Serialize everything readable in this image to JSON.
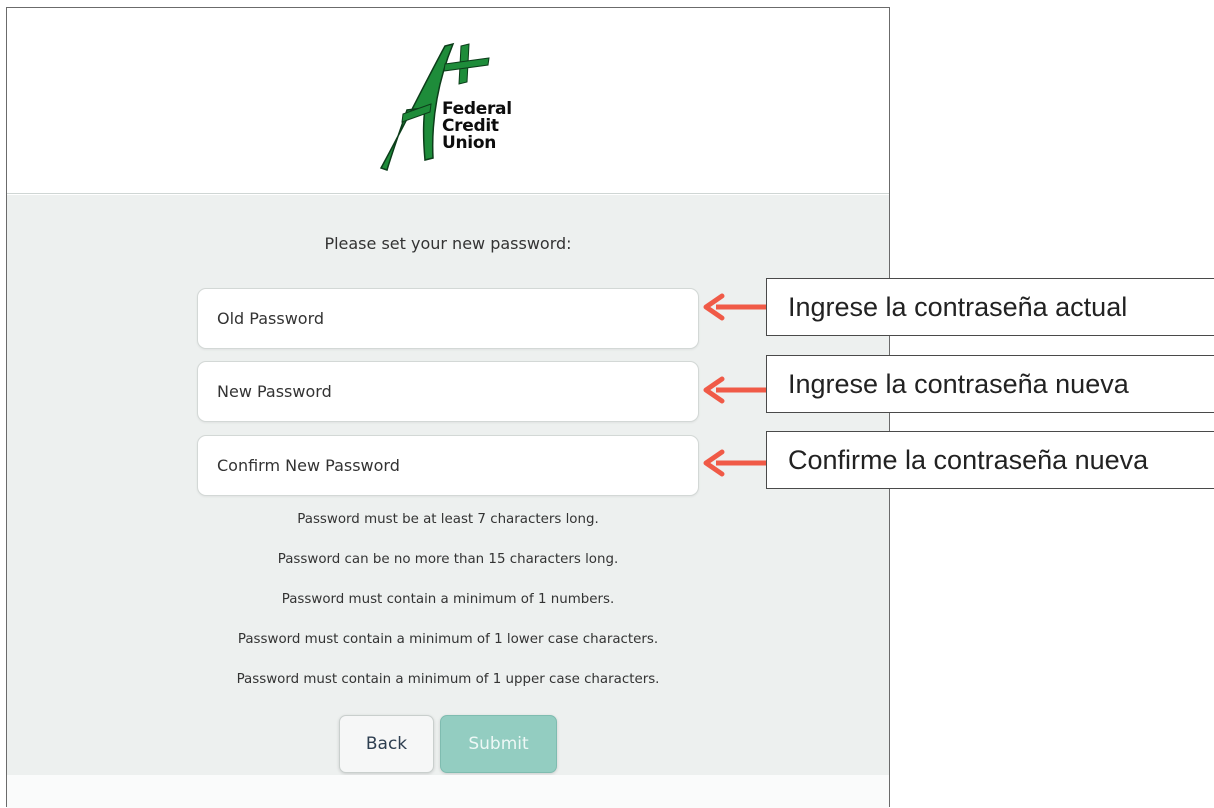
{
  "logo": {
    "mark": "A+",
    "lines": [
      "Federal",
      "Credit",
      "Union"
    ],
    "brand_color": "#1e8c3a"
  },
  "form": {
    "prompt": "Please set your new password:",
    "old_password_placeholder": "Old Password",
    "new_password_placeholder": "New Password",
    "confirm_password_placeholder": "Confirm New Password"
  },
  "rules": [
    "Password must be at least 7 characters long.",
    "Password can be no more than 15 characters long.",
    "Password must contain a minimum of 1 numbers.",
    "Password must contain a minimum of 1 lower case characters.",
    "Password must contain a minimum of 1 upper case characters."
  ],
  "buttons": {
    "back_label": "Back",
    "submit_label": "Submit"
  },
  "callouts": [
    "Ingrese la contraseña actual",
    "Ingrese la contraseña nueva",
    "Confirme la contraseña nueva"
  ],
  "colors": {
    "arrow": "#f05a47",
    "submit_disabled": "#93cdc1",
    "body_background": "#edf0ef"
  }
}
